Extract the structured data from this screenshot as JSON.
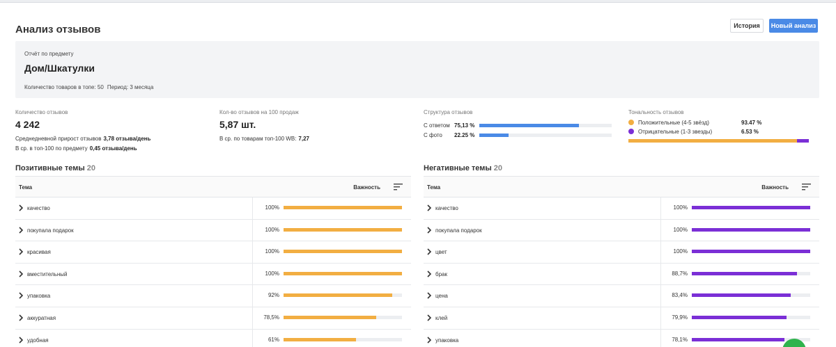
{
  "page": {
    "title": "Анализ отзывов",
    "history_button": "История",
    "new_analysis_button": "Новый анализ"
  },
  "report": {
    "label": "Отчёт по предмету",
    "subject": "Дом/Шкатулки",
    "top_count": "Количество товаров в топе: 50",
    "period": "Период: 3 месяца"
  },
  "stats": {
    "reviews": {
      "label": "Количество отзывов",
      "value": "4 242",
      "daily_label": "Среднедневной прирост отзывов",
      "daily_value": "3,78 отзыва/день",
      "avg_label": "В ср. в топ-100 по предмету",
      "avg_value": "0,45 отзыва/день"
    },
    "per100": {
      "label": "Кол-во отзывов на 100 продаж",
      "value": "5,87 шт.",
      "avg_label": "В ср. по товарам топ-100 WB:",
      "avg_value": "7,27"
    },
    "structure": {
      "label": "Структура отзывов",
      "rows": [
        {
          "label": "С ответом",
          "value": "75,13 %",
          "fraction": 0.7513
        },
        {
          "label": "С фото",
          "value": "22.25 %",
          "fraction": 0.2225
        }
      ]
    },
    "tonality": {
      "label": "Тональность отзывов",
      "rows": [
        {
          "label": "Положительные (4-5 звёзд)",
          "value": "93.47 %",
          "fraction": 0.9347,
          "color": "#f2ae42"
        },
        {
          "label": "Отрицательные (1-3 звезды)",
          "value": "6.53 %",
          "fraction": 0.0653,
          "color": "#7b2fd6"
        }
      ]
    }
  },
  "positive": {
    "title": "Позитивные темы",
    "count": "20",
    "col_topic": "Тема",
    "col_importance": "Важность",
    "color": "#f2ae42",
    "rows": [
      {
        "topic": "качество",
        "pct": "100%",
        "fraction": 1.0
      },
      {
        "topic": "покупала подарок",
        "pct": "100%",
        "fraction": 1.0
      },
      {
        "topic": "красивая",
        "pct": "100%",
        "fraction": 1.0
      },
      {
        "topic": "вместительный",
        "pct": "100%",
        "fraction": 1.0
      },
      {
        "topic": "упаковка",
        "pct": "92%",
        "fraction": 0.92
      },
      {
        "topic": "аккуратная",
        "pct": "78,5%",
        "fraction": 0.785
      },
      {
        "topic": "удобная",
        "pct": "61%",
        "fraction": 0.61
      }
    ]
  },
  "negative": {
    "title": "Негативные темы",
    "count": "20",
    "col_topic": "Тема",
    "col_importance": "Важность",
    "color": "#7b2fd6",
    "rows": [
      {
        "topic": "качество",
        "pct": "100%",
        "fraction": 1.0
      },
      {
        "topic": "покупала подарок",
        "pct": "100%",
        "fraction": 1.0
      },
      {
        "topic": "цвет",
        "pct": "100%",
        "fraction": 1.0
      },
      {
        "topic": "брак",
        "pct": "88,7%",
        "fraction": 0.887
      },
      {
        "topic": "цена",
        "pct": "83,4%",
        "fraction": 0.834
      },
      {
        "topic": "клей",
        "pct": "79,9%",
        "fraction": 0.799
      },
      {
        "topic": "упаковка",
        "pct": "78,1%",
        "fraction": 0.781
      }
    ]
  }
}
